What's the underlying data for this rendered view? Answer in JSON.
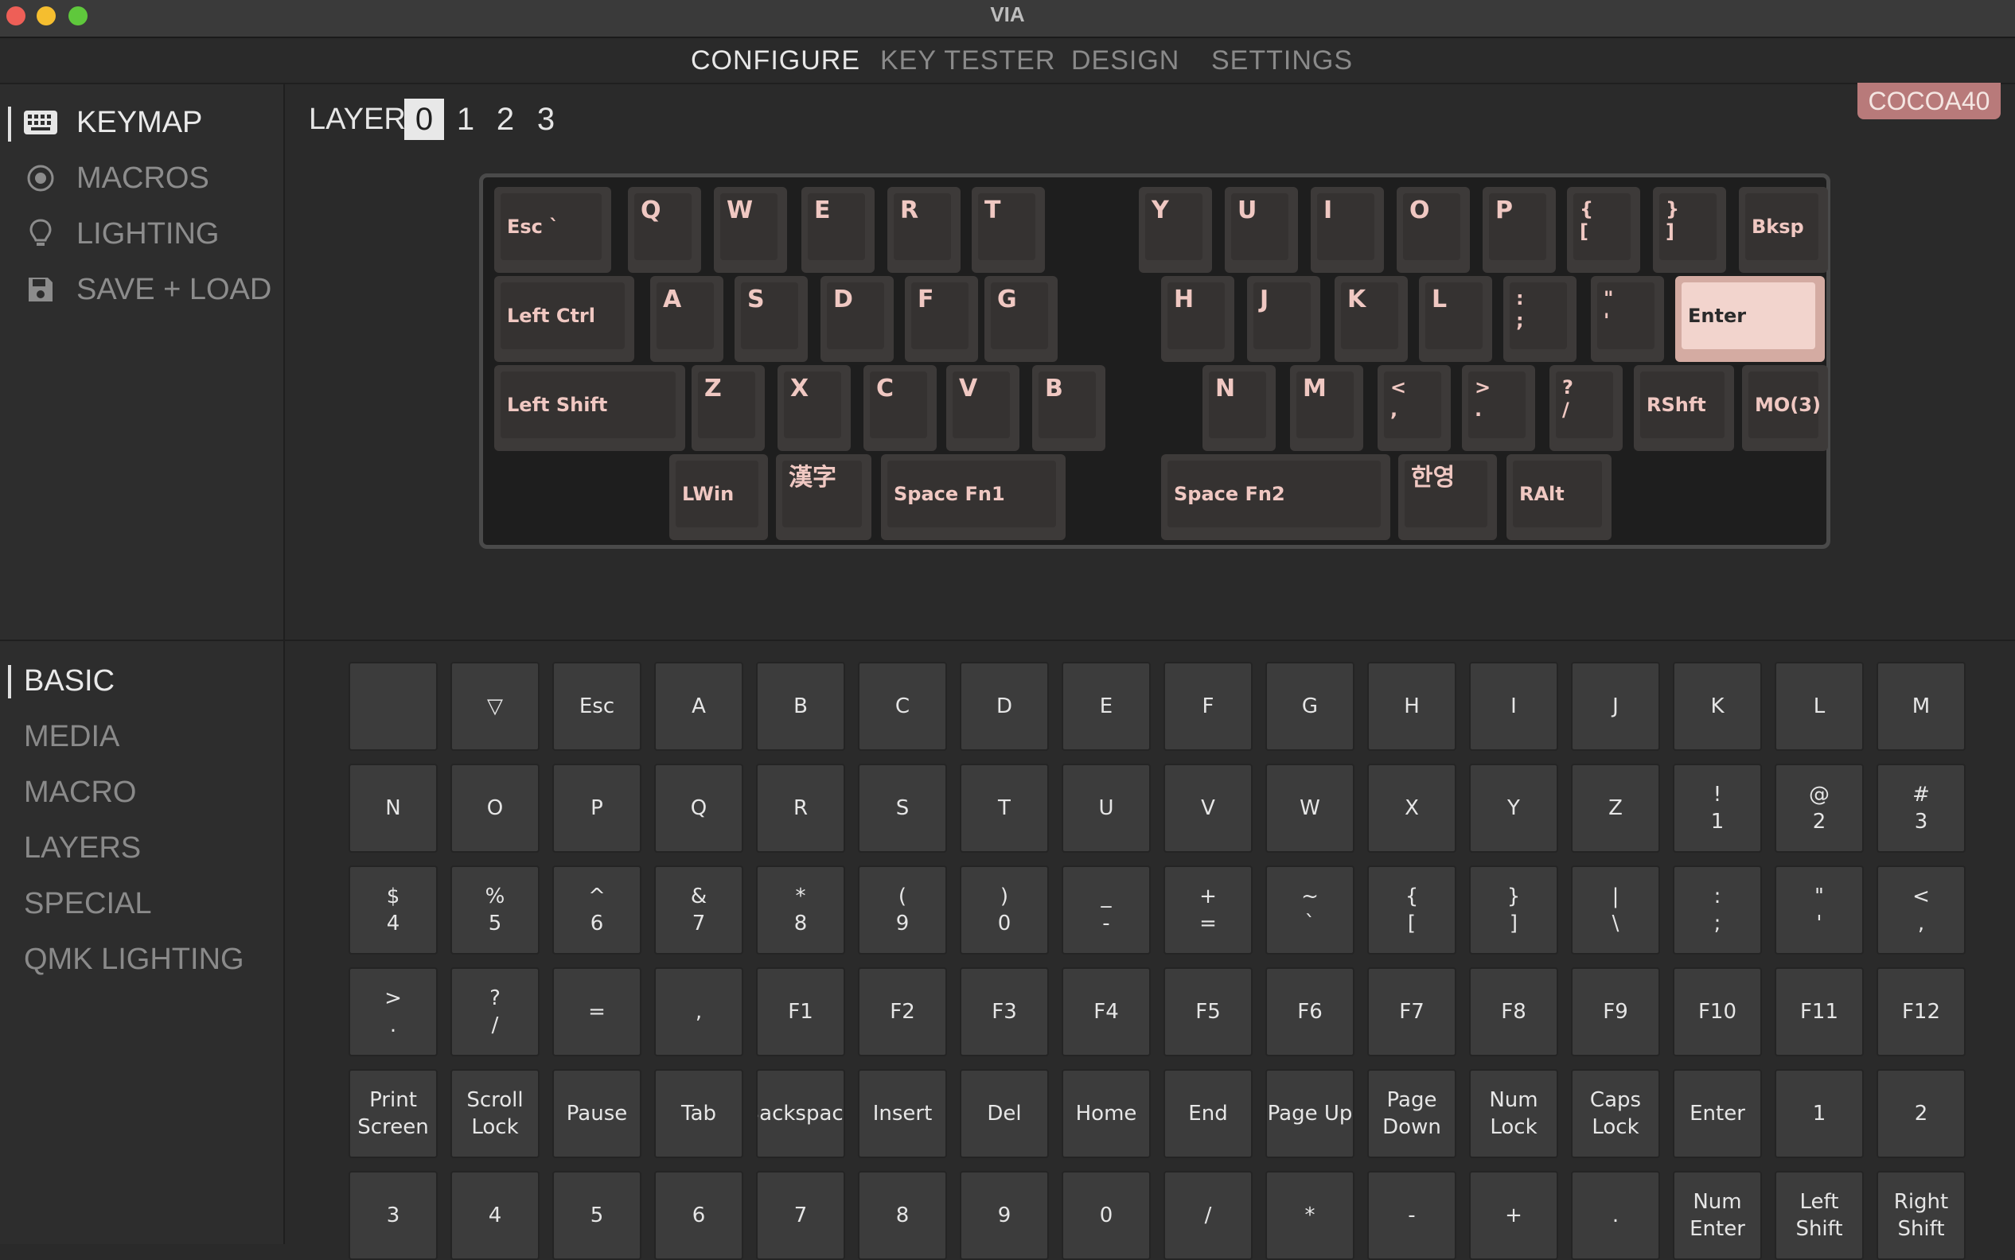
{
  "window": {
    "title": "VIA"
  },
  "tabs": [
    "CONFIGURE",
    "KEY TESTER",
    "DESIGN",
    "SETTINGS"
  ],
  "menu": [
    "KEYMAP",
    "MACROS",
    "LIGHTING",
    "SAVE + LOAD"
  ],
  "layer": {
    "label": "LAYER",
    "numbers": [
      "0",
      "1",
      "2",
      "3"
    ]
  },
  "device": "COCOA40",
  "keymap": [
    "Esc `",
    "Q",
    "W",
    "E",
    "R",
    "T",
    "Y",
    "U",
    "I",
    "O",
    "P",
    "{\n[",
    "}\n]",
    "Bksp",
    "Left Ctrl",
    "A",
    "S",
    "D",
    "F",
    "G",
    "H",
    "J",
    "K",
    "L",
    ":\n;",
    "\"\n'",
    "Enter",
    "Left Shift",
    "Z",
    "X",
    "C",
    "V",
    "B",
    "N",
    "M",
    "<\n,",
    ">\n.",
    "?\n/",
    "RShft",
    "MO(3)",
    "LWin",
    "漢字",
    "Space Fn1",
    "Space Fn2",
    "한영",
    "RAlt"
  ],
  "categories": [
    "BASIC",
    "MEDIA",
    "MACRO",
    "LAYERS",
    "SPECIAL",
    "QMK LIGHTING"
  ],
  "keys": [
    "",
    "▽",
    "Esc",
    "A",
    "B",
    "C",
    "D",
    "E",
    "F",
    "G",
    "H",
    "I",
    "J",
    "K",
    "L",
    "M",
    "N",
    "O",
    "P",
    "Q",
    "R",
    "S",
    "T",
    "U",
    "V",
    "W",
    "X",
    "Y",
    "Z",
    "!\n1",
    "@\n2",
    "#\n3",
    "$\n4",
    "%\n5",
    "^\n6",
    "&\n7",
    "*\n8",
    "(\n9",
    ")\n0",
    "_\n-",
    "+\n=",
    "~\n`",
    "{\n[",
    "}\n]",
    "|\n\\",
    ":\n;",
    "\"\n'",
    "<\n,",
    ">\n.",
    "?\n/",
    "=",
    ",",
    "F1",
    "F2",
    "F3",
    "F4",
    "F5",
    "F6",
    "F7",
    "F8",
    "F9",
    "F10",
    "F11",
    "F12",
    "Print\nScreen",
    "Scroll\nLock",
    "Pause",
    "Tab",
    "Backspace",
    "Insert",
    "Del",
    "Home",
    "End",
    "Page Up",
    "Page\nDown",
    "Num\nLock",
    "Caps\nLock",
    "Enter",
    "1",
    "2",
    "3",
    "4",
    "5",
    "6",
    "7",
    "8",
    "9",
    "0",
    "/",
    "*",
    "-",
    "+",
    ".",
    "Num\nEnter",
    "Left\nShift",
    "Right\nShift"
  ],
  "colors": {
    "accent": "#b87a7a",
    "key_legend": "#f0c8c2",
    "selected_key": "#f2d4cd"
  }
}
